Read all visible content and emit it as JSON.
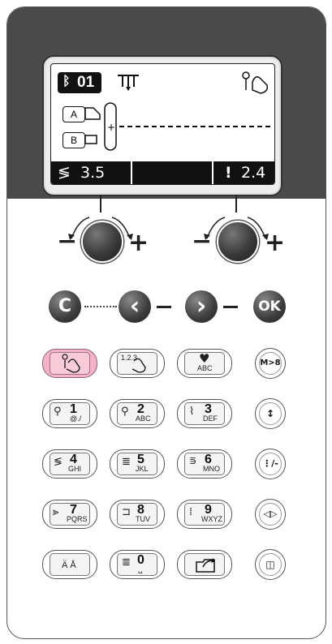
{
  "lcd": {
    "pattern_number": "01",
    "row_a_label": "A",
    "row_b_label": "B",
    "stitch_width": "3.5",
    "stitch_length": "2.4",
    "width_icon": "stitch-width-icon",
    "length_icon": "stitch-length-icon"
  },
  "controls": {
    "clear": "C",
    "prev": "‹",
    "next": "›",
    "ok": "OK",
    "knob_minus": "−",
    "knob_plus": "+"
  },
  "keys": {
    "row1": [
      {
        "icon": "touch-icon",
        "label": ""
      },
      {
        "icon": "numeric-input-icon",
        "label": "1.2.3"
      },
      {
        "icon": "heart-icon",
        "sub": "ABC"
      }
    ],
    "row2": [
      {
        "num": "1",
        "sub": "@./"
      },
      {
        "num": "2",
        "sub": "ABC"
      },
      {
        "num": "3",
        "sub": "DEF"
      }
    ],
    "row3": [
      {
        "num": "4",
        "sub": "GHI"
      },
      {
        "num": "5",
        "sub": "JKL"
      },
      {
        "num": "6",
        "sub": "MNO"
      }
    ],
    "row4": [
      {
        "num": "7",
        "sub": "PQRS"
      },
      {
        "num": "8",
        "sub": "TUV"
      },
      {
        "num": "9",
        "sub": "WXYZ"
      }
    ],
    "row5": [
      {
        "sub": "Ä Å"
      },
      {
        "num": "0",
        "sub": "␣"
      },
      {
        "icon": "folder-export-icon"
      }
    ],
    "side": [
      "M>8",
      "↕",
      "⋮/-",
      "◁▷",
      "◫"
    ]
  }
}
